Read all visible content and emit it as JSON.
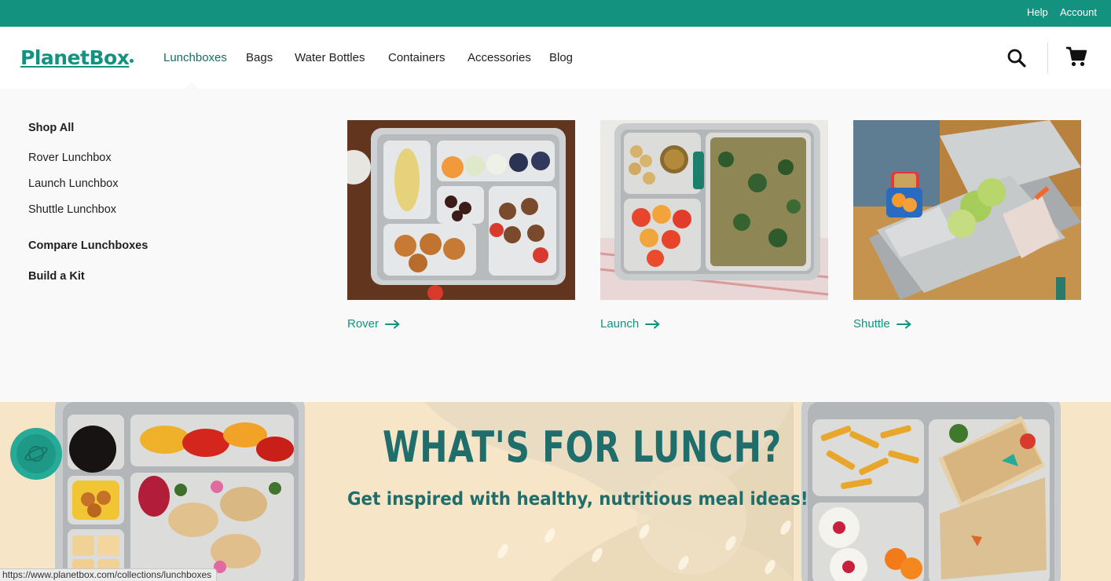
{
  "topbar": {
    "help": "Help",
    "account": "Account"
  },
  "header": {
    "logo": "PlanetBox",
    "nav": [
      "Lunchboxes",
      "Bags",
      "Water Bottles",
      "Containers",
      "Accessories",
      "Blog"
    ],
    "active_nav": "Lunchboxes"
  },
  "mega_menu": {
    "links": [
      "Shop All",
      "Rover Lunchbox",
      "Launch Lunchbox",
      "Shuttle Lunchbox",
      "Compare Lunchboxes",
      "Build a Kit"
    ],
    "cards": [
      {
        "label": "Rover"
      },
      {
        "label": "Launch"
      },
      {
        "label": "Shuttle"
      }
    ]
  },
  "hero": {
    "title": "WHAT'S FOR LUNCH?",
    "subtitle": "Get inspired with healthy, nutritious meal ideas!"
  },
  "status_bar": {
    "url": "https://www.planetbox.com/collections/lunchboxes"
  },
  "icons": [
    "search-icon",
    "cart-icon",
    "arrow-right-icon",
    "planet-icon"
  ],
  "colors": {
    "brand": "#12927f",
    "hero_text": "#1f6e6c",
    "hero_bg": "#f6e5c7",
    "menu_bg": "#f9f9f9"
  }
}
